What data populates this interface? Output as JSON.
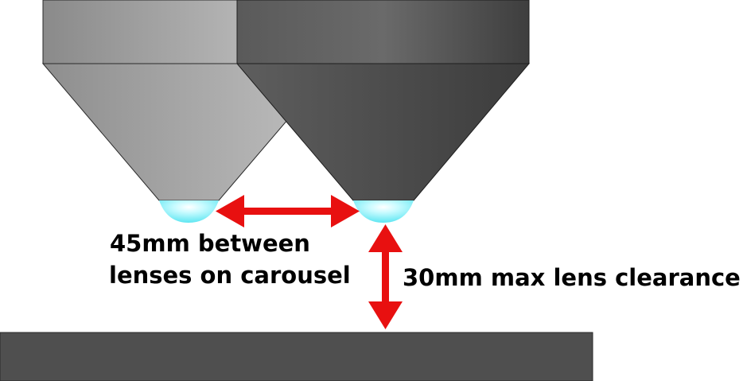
{
  "labels": {
    "spacing_line1": "45mm between",
    "spacing_line2": "lenses on carousel",
    "clearance": "30mm max lens clearance"
  },
  "colors": {
    "arrow": "#e81010",
    "lens_glow": "#8ff6ff",
    "light_objective": "#a5a5a5",
    "dark_objective": "#4c4c4c",
    "stage": "#4f4f4f"
  }
}
